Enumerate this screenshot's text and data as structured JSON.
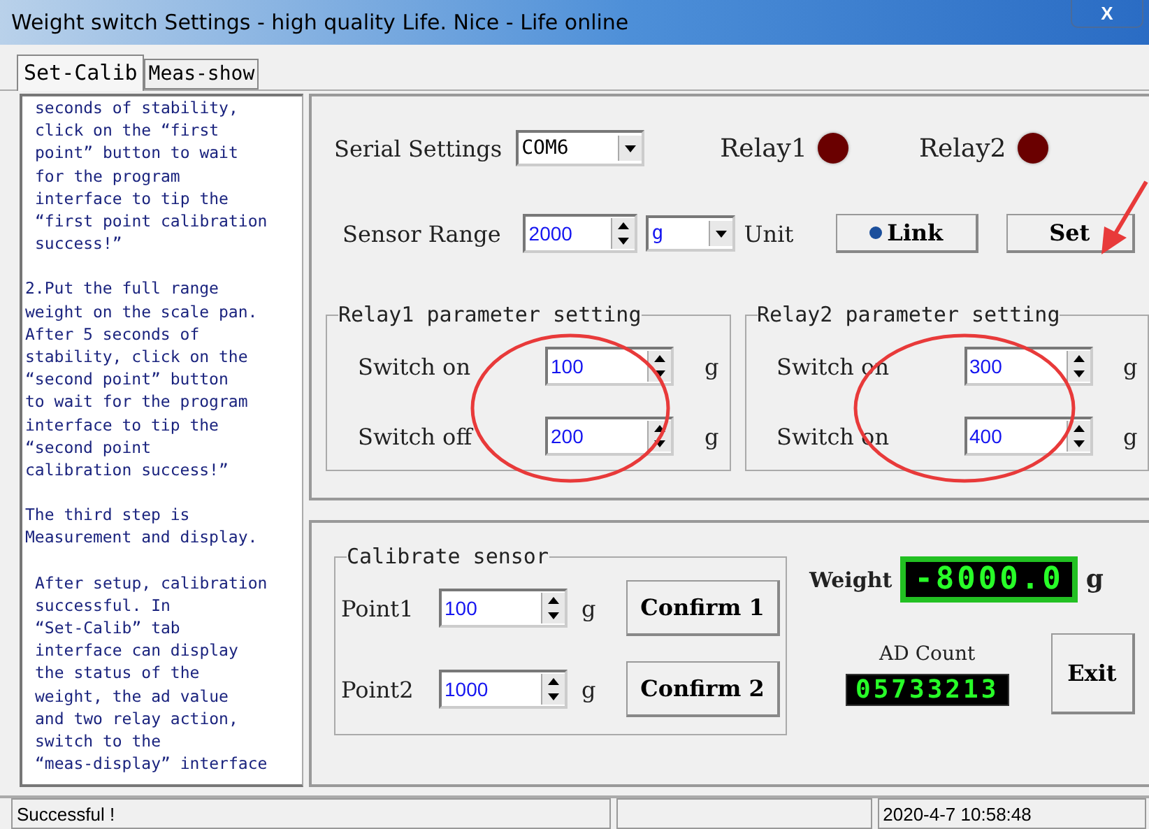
{
  "window": {
    "title": "Weight switch Settings - high quality Life. Nice - Life online",
    "close": "X"
  },
  "tabs": [
    {
      "label": "Set-Calib",
      "selected": true
    },
    {
      "label": "Meas-show",
      "selected": false
    }
  ],
  "instructions": [
    {
      "text": "seconds of stability,\nclick on the “first\npoint” button to wait\nfor the program\ninterface to tip the\n“first point calibration\nsuccess!”",
      "indented": true
    },
    {
      "text": "2.Put the full range\nweight on the scale pan.\nAfter 5 seconds of\nstability, click on the\n“second point” button\nto wait for the program\ninterface to tip the\n“second point\ncalibration success!”",
      "indented": false
    },
    {
      "text": "The third step is\nMeasurement and display.",
      "indented": false
    },
    {
      "text": "After setup, calibration\nsuccessful. In\n“Set-Calib” tab\ninterface can display\nthe status of the\nweight, the ad value\nand two relay action,\nswitch to the\n“meas-display” interface",
      "indented": true
    }
  ],
  "serial": {
    "label": "Serial Settings",
    "value": "COM6"
  },
  "relays": [
    {
      "label": "Relay1",
      "on": false
    },
    {
      "label": "Relay2",
      "on": false
    }
  ],
  "sensor_range": {
    "label": "Sensor Range",
    "value": "2000",
    "unit_value": "g",
    "unit_label": "Unit"
  },
  "link_button": "Link",
  "set_button": "Set",
  "relay_groups": [
    {
      "title": "Relay1 parameter setting",
      "rows": [
        {
          "label": "Switch on",
          "value": "100",
          "unit": "g"
        },
        {
          "label": "Switch off",
          "value": "200",
          "unit": "g"
        }
      ]
    },
    {
      "title": "Relay2 parameter setting",
      "rows": [
        {
          "label": "Switch on",
          "value": "300",
          "unit": "g"
        },
        {
          "label": "Switch on",
          "value": "400",
          "unit": "g"
        }
      ]
    }
  ],
  "calibrate": {
    "title": "Calibrate sensor",
    "points": [
      {
        "label": "Point1",
        "value": "100",
        "unit": "g",
        "button": "Confirm 1"
      },
      {
        "label": "Point2",
        "value": "1000",
        "unit": "g",
        "button": "Confirm 2"
      }
    ]
  },
  "weight": {
    "label": "Weight",
    "value": "-8000.0",
    "unit": "g"
  },
  "ad_count": {
    "label": "AD Count",
    "value": "05733213"
  },
  "exit_button": "Exit",
  "status_bar": {
    "message": "Successful !",
    "datetime": "2020-4-7 10:58:48"
  }
}
